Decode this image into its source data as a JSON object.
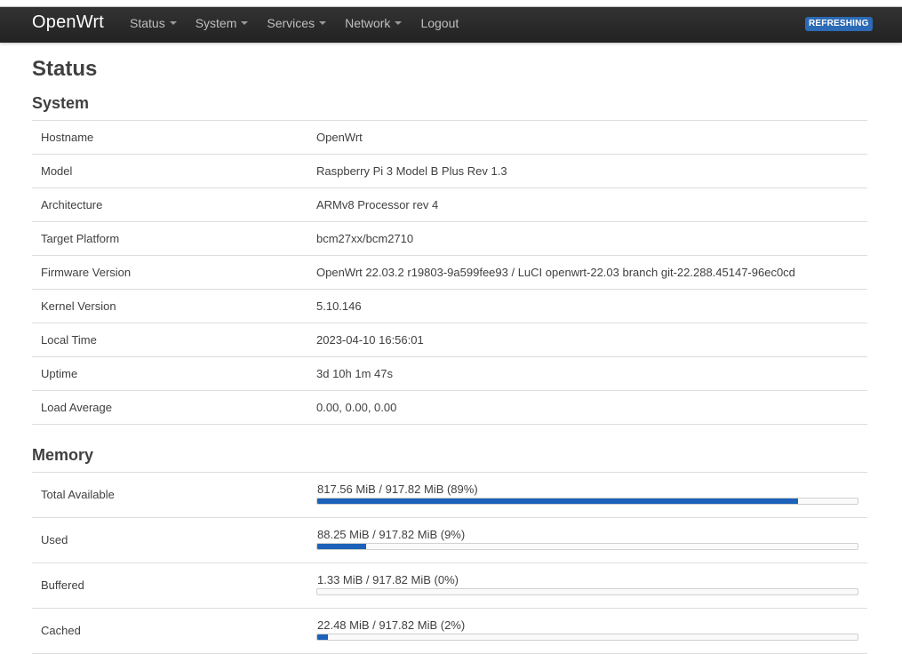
{
  "brand": "OpenWrt",
  "nav": {
    "items": [
      {
        "label": "Status",
        "dropdown": true
      },
      {
        "label": "System",
        "dropdown": true
      },
      {
        "label": "Services",
        "dropdown": true
      },
      {
        "label": "Network",
        "dropdown": true
      },
      {
        "label": "Logout",
        "dropdown": false
      }
    ],
    "badge": "REFRESHING"
  },
  "page_title": "Status",
  "system": {
    "title": "System",
    "rows": [
      {
        "label": "Hostname",
        "value": "OpenWrt"
      },
      {
        "label": "Model",
        "value": "Raspberry Pi 3 Model B Plus Rev 1.3"
      },
      {
        "label": "Architecture",
        "value": "ARMv8 Processor rev 4"
      },
      {
        "label": "Target Platform",
        "value": "bcm27xx/bcm2710"
      },
      {
        "label": "Firmware Version",
        "value": "OpenWrt 22.03.2 r19803-9a599fee93 / LuCI openwrt-22.03 branch git-22.288.45147-96ec0cd"
      },
      {
        "label": "Kernel Version",
        "value": "5.10.146"
      },
      {
        "label": "Local Time",
        "value": "2023-04-10 16:56:01"
      },
      {
        "label": "Uptime",
        "value": "3d 10h 1m 47s"
      },
      {
        "label": "Load Average",
        "value": "0.00, 0.00, 0.00"
      }
    ]
  },
  "memory": {
    "title": "Memory",
    "rows": [
      {
        "label": "Total Available",
        "value": "817.56 MiB / 917.82 MiB (89%)",
        "percent": 89
      },
      {
        "label": "Used",
        "value": "88.25 MiB / 917.82 MiB (9%)",
        "percent": 9
      },
      {
        "label": "Buffered",
        "value": "1.33 MiB / 917.82 MiB (0%)",
        "percent": 0
      },
      {
        "label": "Cached",
        "value": "22.48 MiB / 917.82 MiB (2%)",
        "percent": 2
      }
    ]
  },
  "colors": {
    "navbar": "#222222",
    "accent": "#2c6ab5",
    "progress_fill": "#1c62b8"
  }
}
